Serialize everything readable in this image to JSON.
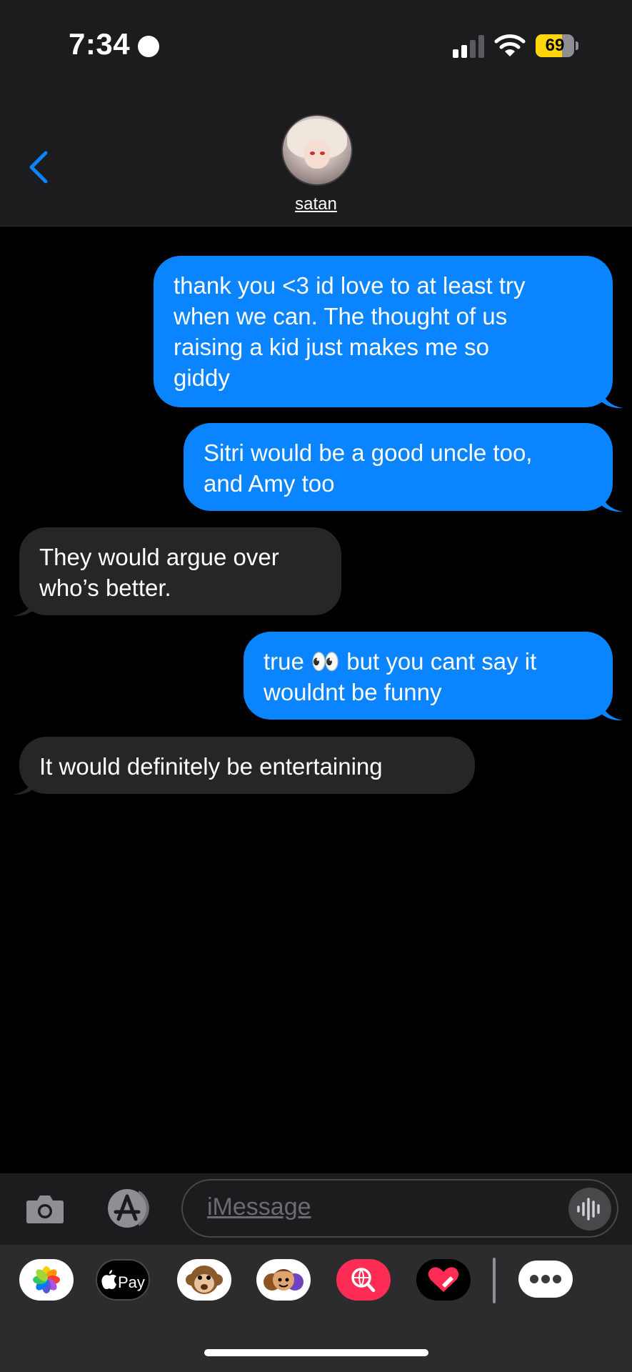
{
  "status_bar": {
    "time": "7:34",
    "battery_percent": "69",
    "battery_level": 0.69,
    "signal_bars_active": 2,
    "battery_color": "#ffd60a"
  },
  "header": {
    "contact_name": "satan",
    "back_icon": "chevron-left-icon",
    "accent": "#0a84ff"
  },
  "messages": [
    {
      "direction": "outgoing",
      "text": "thank you <3 id love to at least try\nwhen we can. The thought of us\nraising a kid just makes me so\ngiddy"
    },
    {
      "direction": "outgoing",
      "text": "Sitri would be a good uncle too,\nand Amy too"
    },
    {
      "direction": "incoming",
      "text": "They would argue over\nwho’s better."
    },
    {
      "direction": "outgoing",
      "text": "true 👀 but you cant say it\nwouldnt be funny"
    },
    {
      "direction": "incoming",
      "text": "It would definitely be entertaining"
    }
  ],
  "input": {
    "placeholder": "iMessage"
  },
  "app_strip": [
    {
      "name": "photos-app-icon"
    },
    {
      "name": "apple-pay-icon",
      "label": "Pay"
    },
    {
      "name": "animoji-monkey-icon"
    },
    {
      "name": "memoji-icon"
    },
    {
      "name": "image-search-icon"
    },
    {
      "name": "digital-touch-heart-icon"
    },
    {
      "name": "more-apps-icon"
    }
  ],
  "colors": {
    "outgoing_bubble": "#0a84ff",
    "incoming_bubble": "#262628",
    "background": "#000000"
  }
}
